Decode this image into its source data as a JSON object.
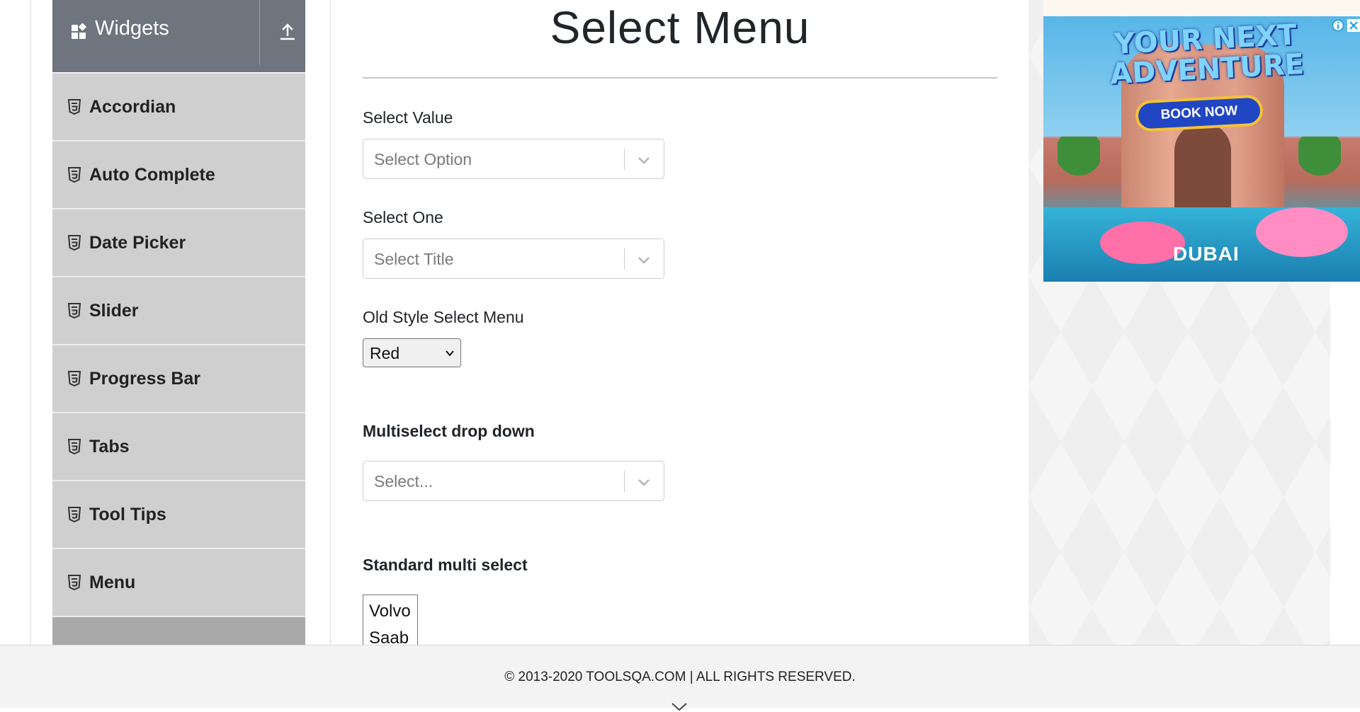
{
  "sidebar": {
    "group_title": "Widgets",
    "items": [
      {
        "label": "Accordian"
      },
      {
        "label": "Auto Complete"
      },
      {
        "label": "Date Picker"
      },
      {
        "label": "Slider"
      },
      {
        "label": "Progress Bar"
      },
      {
        "label": "Tabs"
      },
      {
        "label": "Tool Tips"
      },
      {
        "label": "Menu"
      }
    ]
  },
  "main": {
    "title": "Select Menu",
    "select_value": {
      "label": "Select Value",
      "placeholder": "Select Option"
    },
    "select_one": {
      "label": "Select One",
      "placeholder": "Select Title"
    },
    "old_style": {
      "label": "Old Style Select Menu",
      "selected": "Red"
    },
    "multiselect": {
      "label": "Multiselect drop down",
      "placeholder": "Select..."
    },
    "standard_multi": {
      "label": "Standard multi select",
      "options": [
        "Volvo",
        "Saab"
      ]
    }
  },
  "ad": {
    "headline": "YOUR NEXT ADVENTURE",
    "cta": "BOOK NOW",
    "brand": "DUBAI"
  },
  "footer": {
    "copyright": "© 2013-2020 TOOLSQA.COM | ALL RIGHTS RESERVED."
  },
  "colors": {
    "sidebar_header": "#6f757e",
    "sidebar_item": "#cfcfcf",
    "footer_bg": "#f3f3f3",
    "ad_cta": "#2046c4"
  }
}
